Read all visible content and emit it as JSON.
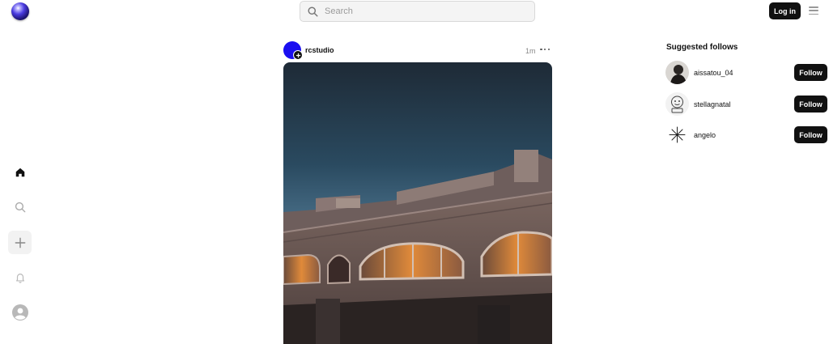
{
  "header": {
    "logo_icon": "globe-logo-icon",
    "search": {
      "placeholder": "Search",
      "value": "",
      "icon": "search-icon"
    },
    "login_label": "Log in",
    "menu_icon": "hamburger-menu-icon"
  },
  "nav": {
    "items": [
      {
        "name": "home",
        "icon": "home-icon",
        "active": true
      },
      {
        "name": "search",
        "icon": "search-icon",
        "active": false
      },
      {
        "name": "create",
        "icon": "plus-icon",
        "active": false
      },
      {
        "name": "notifications",
        "icon": "bell-icon",
        "active": false
      },
      {
        "name": "profile",
        "icon": "user-avatar-icon",
        "active": false
      }
    ]
  },
  "post": {
    "username": "rcstudio",
    "time": "1m",
    "more_icon": "more-options-icon",
    "avatar_color": "#1a0ef0",
    "photo": "dusk-building-photo"
  },
  "suggestions": {
    "title": "Suggested follows",
    "follow_label": "Follow",
    "users": [
      {
        "username": "aissatou_04"
      },
      {
        "username": "stellagnatal"
      },
      {
        "username": "angelo"
      }
    ]
  },
  "colors": {
    "button_bg": "#111111",
    "button_text": "#ffffff",
    "search_bg": "#f4f4f4"
  }
}
